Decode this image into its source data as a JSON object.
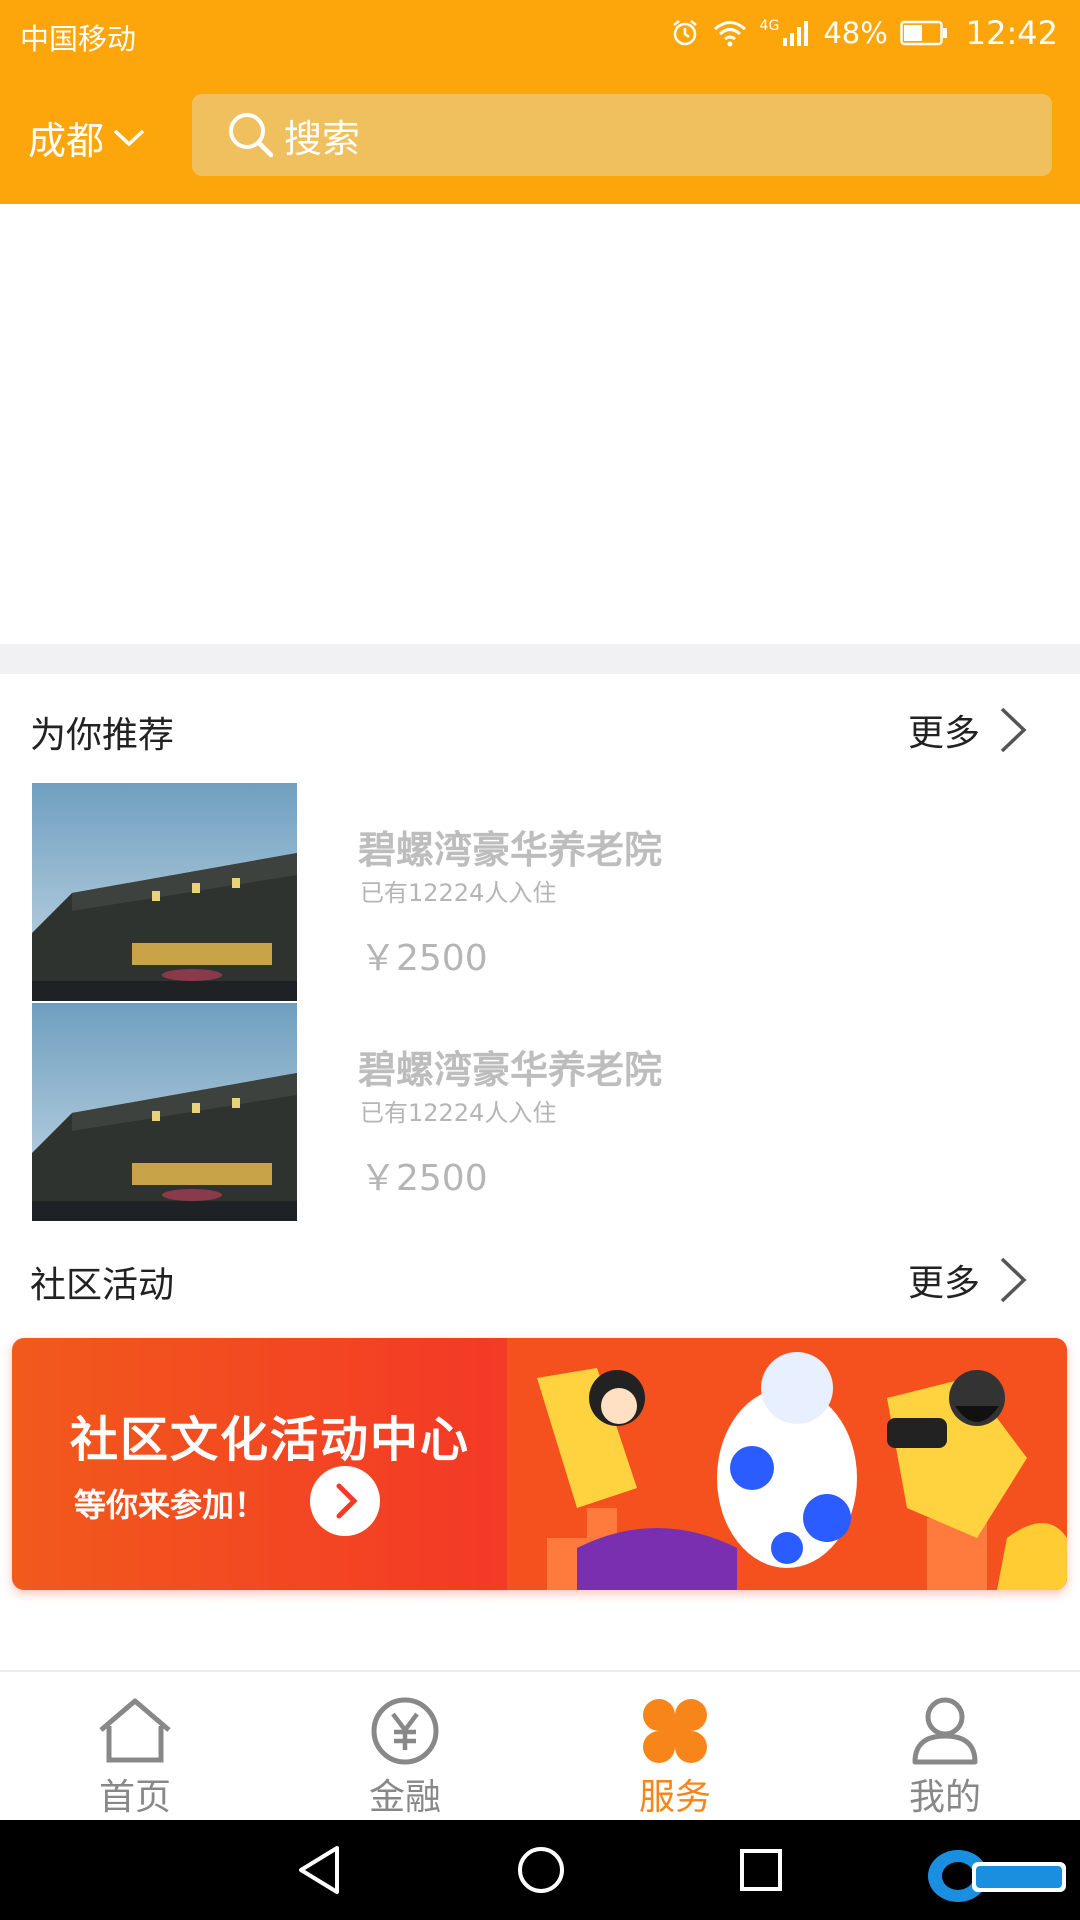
{
  "status_bar": {
    "carrier": "中国移动",
    "network": "4G",
    "battery": "48%",
    "time": "12:42"
  },
  "header": {
    "city": "成都",
    "search_placeholder": "搜索"
  },
  "recommend": {
    "title": "为你推荐",
    "more_label": "更多",
    "items": [
      {
        "name": "碧螺湾豪华养老院",
        "count": "已有12224人入住",
        "price": "￥2500"
      },
      {
        "name": "碧螺湾豪华养老院",
        "count": "已有12224人入住",
        "price": "￥2500"
      }
    ]
  },
  "activity": {
    "title": "社区活动",
    "more_label": "更多",
    "banner_headline": "社区文化活动中心",
    "banner_sub": "等你来参加！"
  },
  "tabbar": {
    "tabs": [
      {
        "label": "首页",
        "icon": "home-icon"
      },
      {
        "label": "金融",
        "icon": "yen-icon"
      },
      {
        "label": "服务",
        "icon": "services-icon",
        "active": true
      },
      {
        "label": "我的",
        "icon": "user-icon"
      }
    ]
  },
  "colors": {
    "brand": "#fda60b",
    "active_tab": "#f7851a",
    "banner": "#f33a26"
  }
}
